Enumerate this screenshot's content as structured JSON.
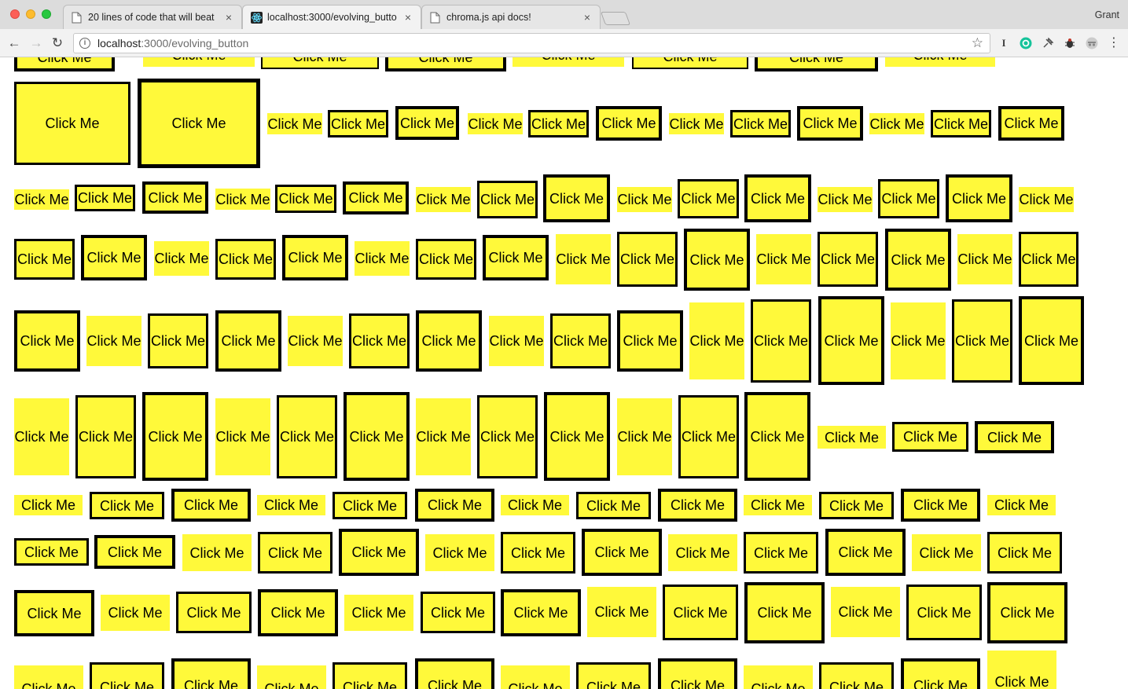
{
  "browser": {
    "tabs": [
      {
        "title": "20 lines of code that will beat",
        "icon": "page-icon",
        "active": false
      },
      {
        "title": "localhost:3000/evolving_butto",
        "icon": "react-icon",
        "active": true
      },
      {
        "title": "chroma.js api docs!",
        "icon": "page-icon",
        "active": false
      }
    ],
    "close_glyph": "×",
    "profile_name": "Grant",
    "url_host": "localhost",
    "url_path": ":3000/evolving_button"
  },
  "page": {
    "button_label": "Click Me",
    "button_color": "#fff93a",
    "border_color": "#000000"
  }
}
